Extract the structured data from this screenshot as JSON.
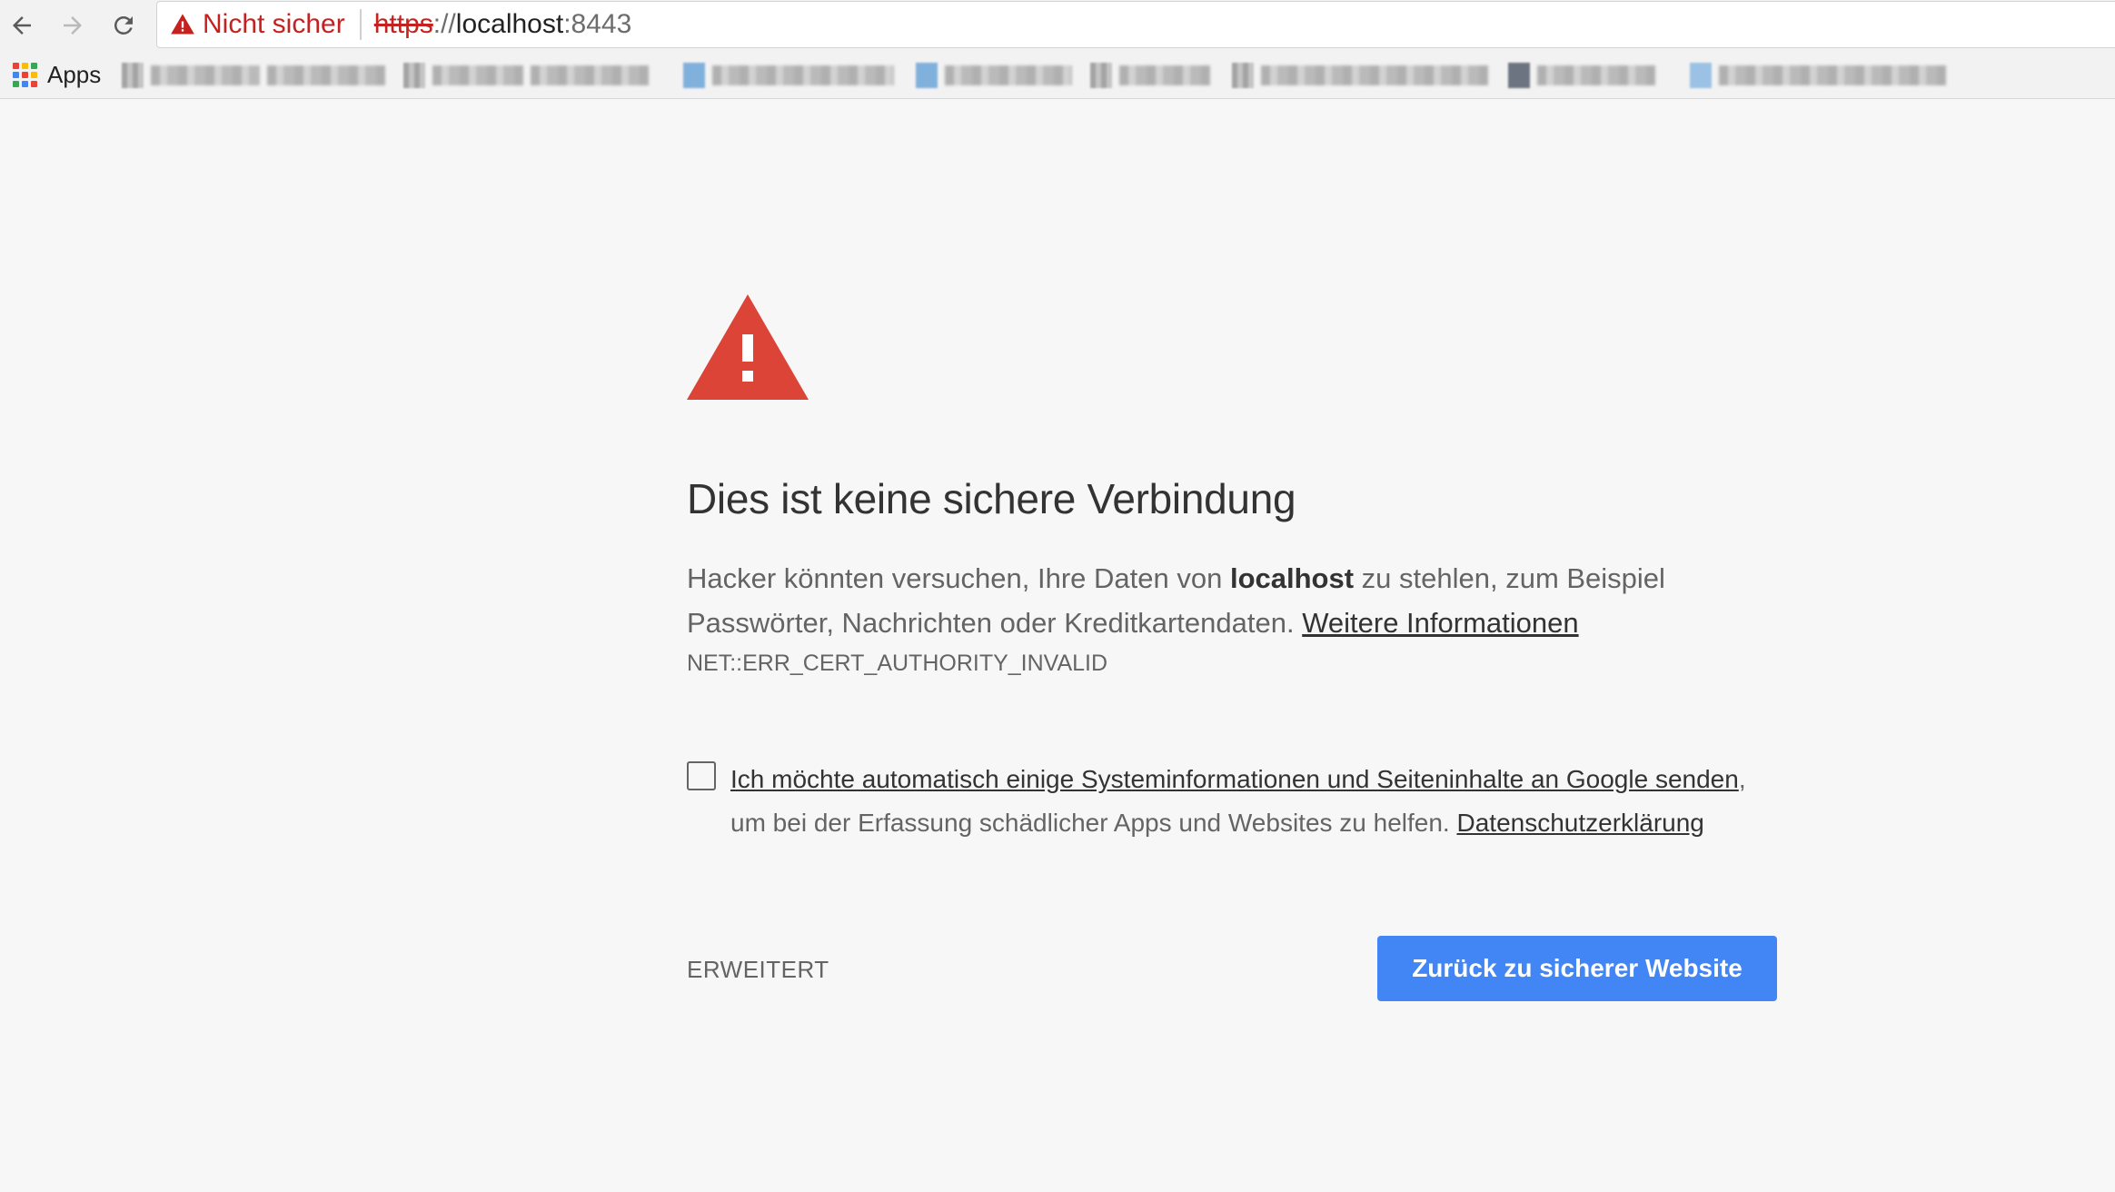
{
  "browser": {
    "security_label": "Nicht sicher",
    "url": {
      "scheme": "https",
      "separator": "://",
      "host": "localhost",
      "port": ":8443"
    },
    "icons": {
      "back": "arrow-left-icon",
      "forward": "arrow-right-icon",
      "reload": "reload-icon",
      "security": "warning-triangle-icon"
    }
  },
  "bookmarks": {
    "apps_label": "Apps",
    "apps_icon": "apps-grid-icon"
  },
  "interstitial": {
    "heading": "Dies ist keine sichere Verbindung",
    "message_before_host": "Hacker könnten versuchen, Ihre Daten von ",
    "host": "localhost",
    "message_after_host": " zu stehlen, zum Beispiel Passwörter, Nachrichten oder Kreditkartendaten. ",
    "learn_more": "Weitere Informationen",
    "error_code": "NET::ERR_CERT_AUTHORITY_INVALID",
    "opt_in_link": "Ich möchte automatisch einige Systeminformationen und Seiteninhalte an Google senden",
    "opt_in_rest": ", um bei der Erfassung schädlicher Apps und Websites zu helfen. ",
    "privacy_link": "Datenschutzerklärung",
    "advanced_label": "ERWEITERT",
    "back_button_label": "Zurück zu sicherer Website"
  },
  "colors": {
    "warning_red": "#db4437",
    "primary_blue": "#4285f4",
    "background": "#f7f7f7"
  }
}
